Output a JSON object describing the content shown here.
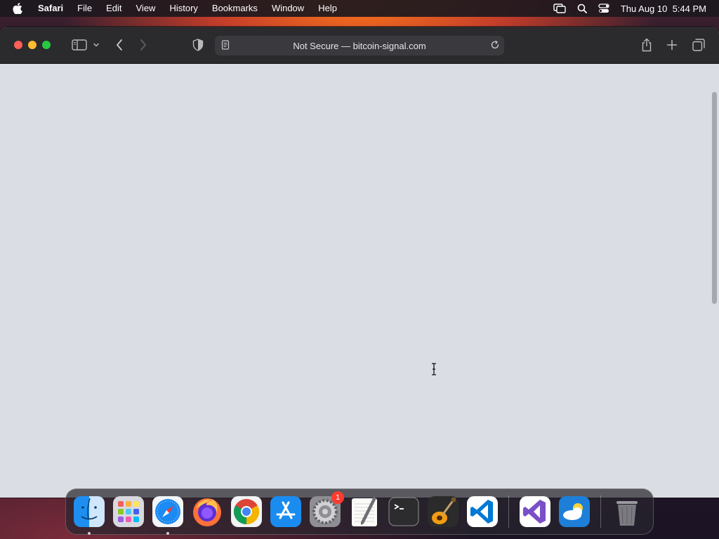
{
  "menubar": {
    "app_name": "Safari",
    "items": [
      "File",
      "Edit",
      "View",
      "History",
      "Bookmarks",
      "Window",
      "Help"
    ],
    "datetime": "Thu Aug 10  5:44 PM"
  },
  "browser": {
    "address": "Not Secure — bitcoin-signal.com"
  },
  "dock": {
    "apps": [
      "Finder",
      "Launchpad",
      "Safari",
      "Firefox",
      "Chrome",
      "App Store",
      "System Settings",
      "TextEdit",
      "Terminal",
      "GarageBand",
      "Visual Studio Code",
      "Visual Studio",
      "Weather",
      "Trash"
    ],
    "settings_badge": "1"
  }
}
